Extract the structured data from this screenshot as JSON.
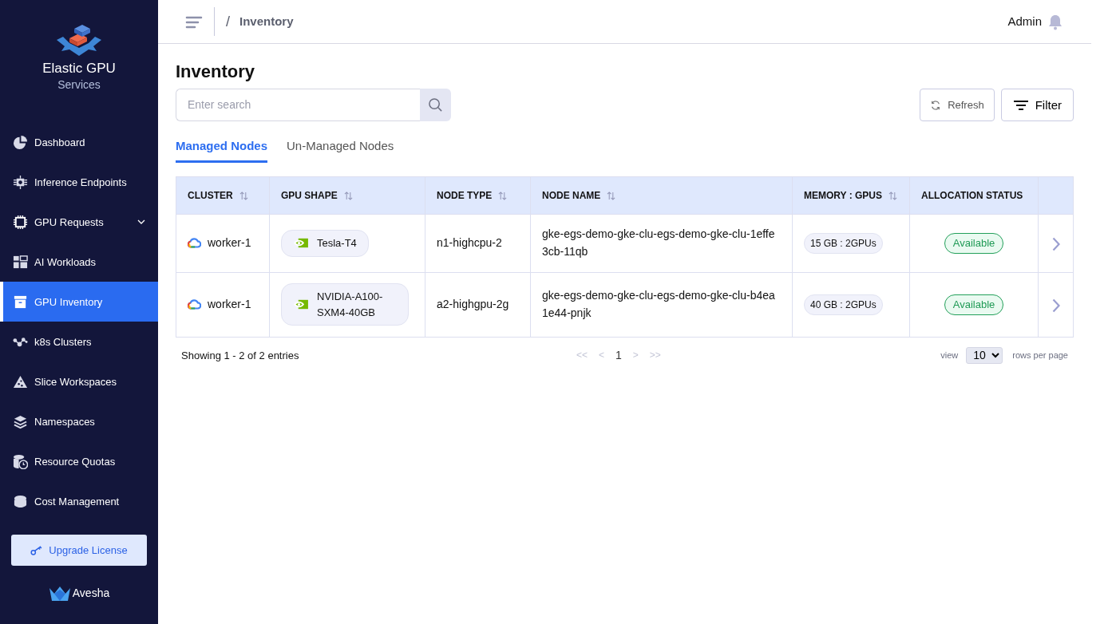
{
  "sidebar": {
    "brand": {
      "title": "Elastic GPU",
      "subtitle": "Services"
    },
    "items": [
      {
        "label": "Dashboard",
        "kind": "link",
        "selected": false
      },
      {
        "label": "Inference Endpoints",
        "kind": "link",
        "selected": false
      },
      {
        "label": "GPU Requests",
        "kind": "group",
        "selected": false
      },
      {
        "label": "AI Workloads",
        "kind": "link",
        "selected": false
      },
      {
        "label": "GPU Inventory",
        "kind": "link",
        "selected": true
      },
      {
        "label": "k8s Clusters",
        "kind": "link",
        "selected": false
      },
      {
        "label": "Slice Workspaces",
        "kind": "link",
        "selected": false
      },
      {
        "label": "Namespaces",
        "kind": "link",
        "selected": false
      },
      {
        "label": "Resource Quotas",
        "kind": "link",
        "selected": false
      },
      {
        "label": "Cost Management",
        "kind": "link",
        "selected": false
      }
    ],
    "upgrade_button": "Upgrade License",
    "footer_logo": "Avesha"
  },
  "header": {
    "separator": "/",
    "breadcrumb": "Inventory",
    "user": "Admin"
  },
  "page": {
    "title": "Inventory",
    "search": {
      "placeholder": "Enter search"
    },
    "buttons": [
      "Refresh",
      "Filter"
    ]
  },
  "tabs": [
    {
      "label": "Managed Nodes",
      "selected": true
    },
    {
      "label": "Un-Managed Nodes",
      "selected": false
    }
  ],
  "table": {
    "columns": [
      {
        "label": "CLUSTER",
        "sortable": true
      },
      {
        "label": "GPU SHAPE",
        "sortable": true
      },
      {
        "label": "NODE TYPE",
        "sortable": true
      },
      {
        "label": "NODE NAME",
        "sortable": true
      },
      {
        "label": "MEMORY : GPUS",
        "sortable": true
      },
      {
        "label": "ALLOCATION STATUS",
        "sortable": false
      }
    ],
    "rows": [
      {
        "cluster": "worker-1",
        "gpu_shape": "Tesla-T4",
        "node_type": "n1-highcpu-2",
        "node_name": "gke-egs-demo-gke-clu-egs-demo-gke-clu-1effe3cb-11qb",
        "memory_gpus": "15 GB : 2GPUs",
        "status": "Available"
      },
      {
        "cluster": "worker-1",
        "gpu_shape": "NVIDIA-A100-SXM4-40GB",
        "node_type": "a2-highgpu-2g",
        "node_name": "gke-egs-demo-gke-clu-egs-demo-gke-clu-b4ea1e44-pnjk",
        "memory_gpus": "40 GB : 2GPUs",
        "status": "Available"
      }
    ]
  },
  "footer": {
    "summary": "Showing 1 - 2 of 2 entries",
    "pages": [
      {
        "label": "<<",
        "disabled": true,
        "selected": false
      },
      {
        "label": "<",
        "disabled": true,
        "selected": false
      },
      {
        "label": "1",
        "disabled": false,
        "selected": true
      },
      {
        "label": ">",
        "disabled": true,
        "selected": false
      },
      {
        "label": ">>",
        "disabled": true,
        "selected": false
      }
    ],
    "view_label": "view",
    "rows_per_page": "10",
    "rows_label": "rows per page"
  }
}
